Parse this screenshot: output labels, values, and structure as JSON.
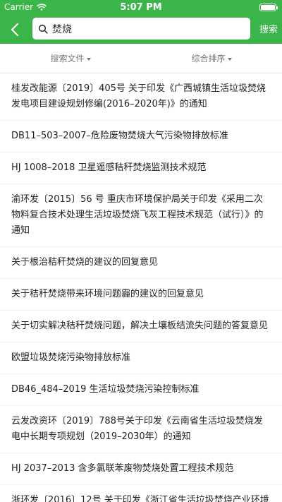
{
  "status_bar": {
    "carrier": "Carrier",
    "time": "5:07 PM"
  },
  "header": {
    "search_value": "焚烧",
    "search_button": "搜索",
    "icons": [
      "back-arrow-icon",
      "search-icon"
    ],
    "accent_color": "#3bb54a"
  },
  "filters": [
    {
      "label": "搜索文件"
    },
    {
      "label": "综合排序"
    }
  ],
  "results": [
    "桂发改能源〔2019〕405号 关于印发《广西城镇生活垃圾焚烧发电项目建设规划修编(2016–2020年)》的通知",
    "DB11–503–2007–危险废物焚烧大气污染物排放标准",
    "HJ 1008–2018 卫星遥感秸秆焚烧监测技术规范",
    "渝环发〔2015〕56 号 重庆市环境保护局关于印发《采用二次物料复合技术处理生活垃圾焚烧飞灰工程技术规范（试行）》的通知",
    "关于根治秸秆焚烧的建议的回复意见",
    "关于秸秆焚烧带来环境问题霾的建议的回复意见",
    "关于切实解决秸秆焚烧问题，解决土壤板结流失问题的答复意见",
    "欧盟垃圾焚烧污染物排放标准",
    "DB46_484–2019 生活垃圾焚烧污染控制标准",
    "云发改资环〔2019〕788号关于印发《云南省生活垃圾焚烧发电中长期专项规划（2019–2030年）的通知",
    "HJ 2037–2013 含多氯联苯废物焚烧处置工程技术规范",
    "浙环发〔2016〕12号 关于印发《浙江省生活垃圾焚烧产业环境"
  ]
}
